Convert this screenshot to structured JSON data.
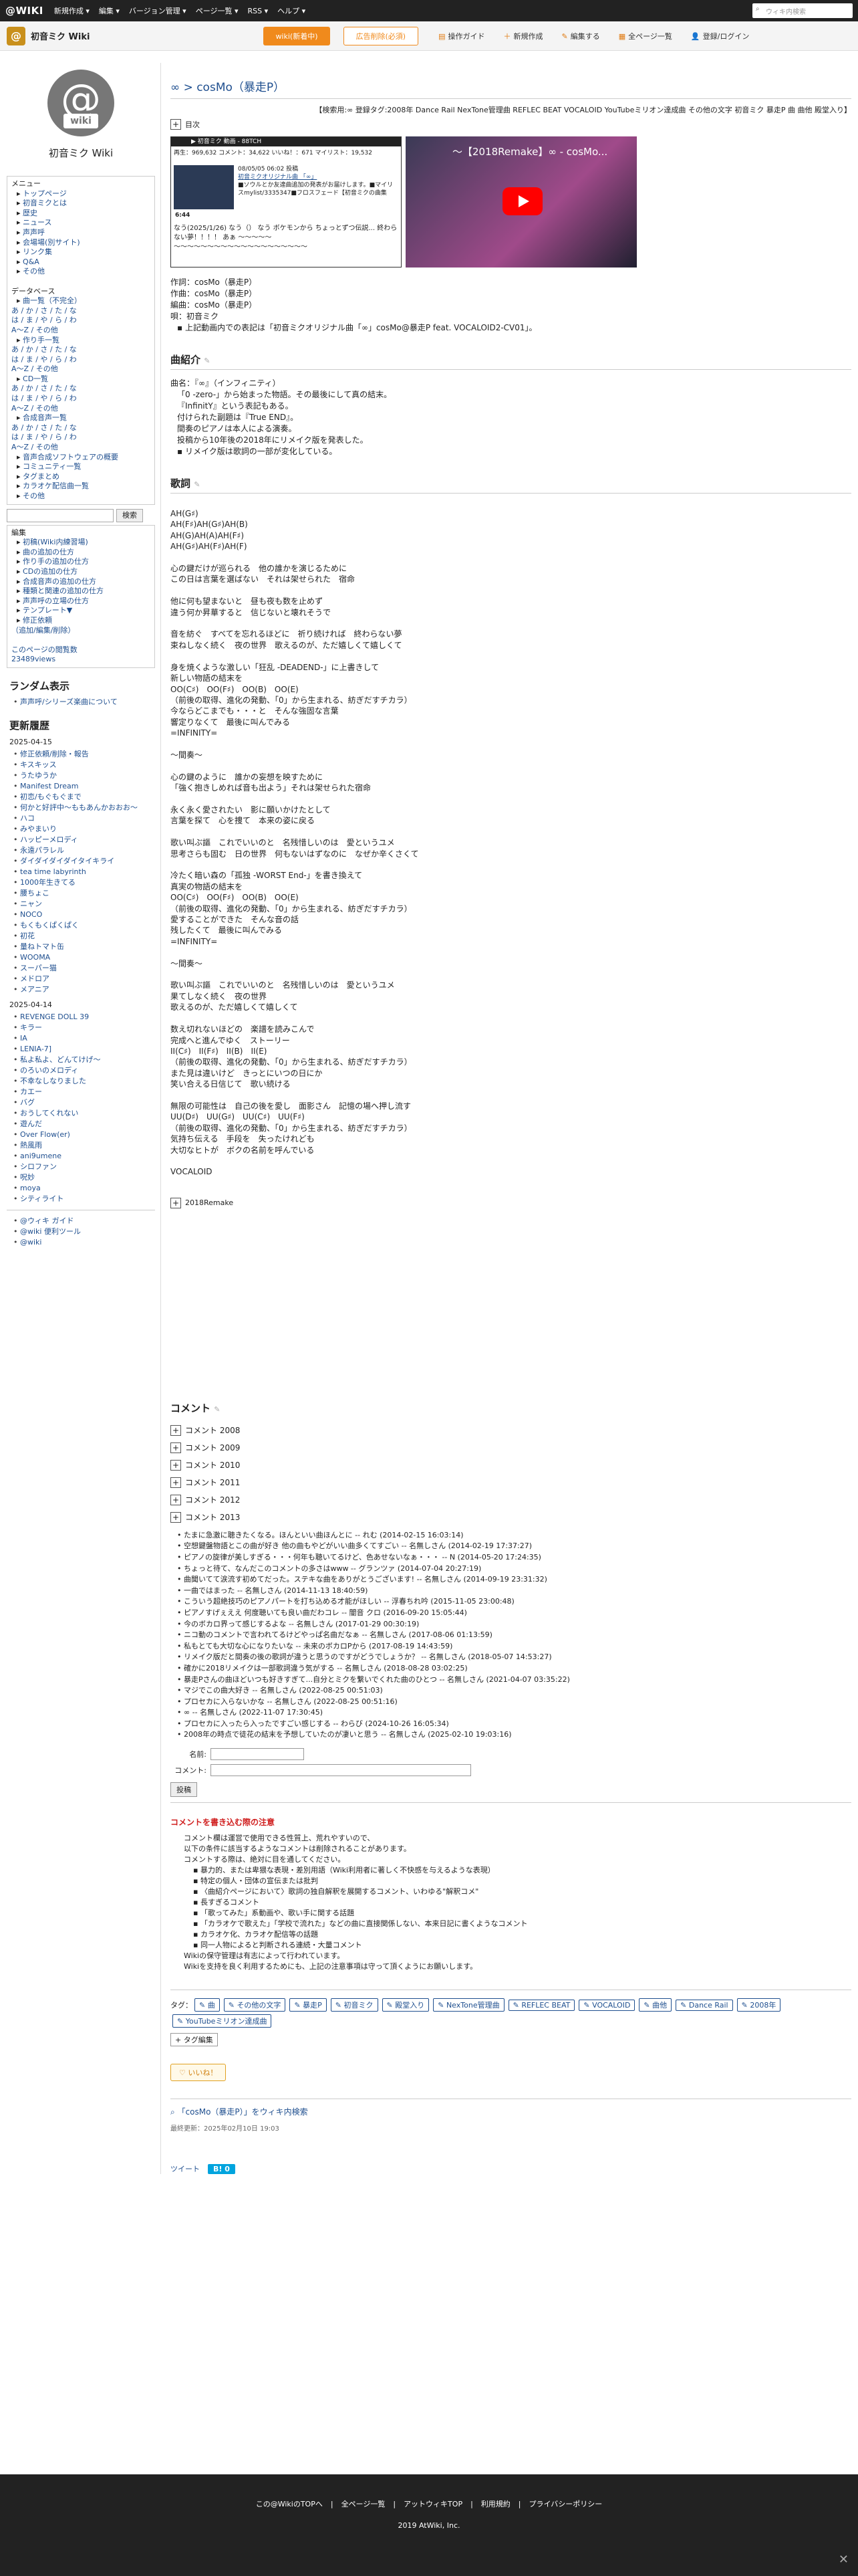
{
  "topbar": {
    "logo": "@WIKI",
    "menus": [
      "新規作成 ▾",
      "編集 ▾",
      "バージョン管理 ▾",
      "ページ一覧 ▾",
      "RSS ▾",
      "ヘルプ ▾"
    ],
    "search_placeholder": "ウィキ内検索"
  },
  "subbar": {
    "site_title": "初音ミク Wiki",
    "wiki_button": "wiki(新着中)",
    "ad_button": "広告削除(必須)",
    "tools": [
      "操作ガイド",
      "新規作成",
      "編集する",
      "全ページ一覧",
      "登録/ログイン"
    ]
  },
  "sidebar": {
    "sitename": "初音ミク Wiki",
    "menu": [
      {
        "text": "メニュー",
        "cls": "head"
      },
      {
        "text": "トップページ",
        "cls": "sub"
      },
      {
        "text": "初音ミクとは",
        "cls": "sub"
      },
      {
        "text": "歴史",
        "cls": "sub"
      },
      {
        "text": "ニュース",
        "cls": "sub"
      },
      {
        "text": "声声呼",
        "cls": "sub"
      },
      {
        "text": "会場場(別サイト)",
        "cls": "sub"
      },
      {
        "text": "リンク集",
        "cls": "sub"
      },
      {
        "text": "Q&A",
        "cls": "sub"
      },
      {
        "text": "その他",
        "cls": "sub"
      },
      {
        "text": "",
        "cls": ""
      },
      {
        "text": "データベース",
        "cls": "head"
      },
      {
        "text": "曲一覧（不完全）",
        "cls": "sub"
      },
      {
        "text": "あ / か / さ / た / な",
        "cls": ""
      },
      {
        "text": "は / ま / や / ら / わ",
        "cls": ""
      },
      {
        "text": "A〜Z / その他",
        "cls": ""
      },
      {
        "text": "作り手一覧",
        "cls": "sub"
      },
      {
        "text": "あ / か / さ / た / な",
        "cls": ""
      },
      {
        "text": "は / ま / や / ら / わ",
        "cls": ""
      },
      {
        "text": "A〜Z / その他",
        "cls": ""
      },
      {
        "text": "CD一覧",
        "cls": "sub"
      },
      {
        "text": "あ / か / さ / た / な",
        "cls": ""
      },
      {
        "text": "は / ま / や / ら / わ",
        "cls": ""
      },
      {
        "text": "A〜Z / その他",
        "cls": ""
      },
      {
        "text": "合成音声一覧",
        "cls": "sub"
      },
      {
        "text": "あ / か / さ / た / な",
        "cls": ""
      },
      {
        "text": "は / ま / や / ら / わ",
        "cls": ""
      },
      {
        "text": "A〜Z / その他",
        "cls": ""
      },
      {
        "text": "音声合成ソフトウェアの概要",
        "cls": "sub"
      },
      {
        "text": "コミュニティ一覧",
        "cls": "sub"
      },
      {
        "text": "タグまとめ",
        "cls": "sub"
      },
      {
        "text": "カラオケ配信曲一覧",
        "cls": "sub"
      },
      {
        "text": "その他",
        "cls": "sub"
      }
    ],
    "search_button": "検索",
    "edit_menu": [
      {
        "text": "編集",
        "cls": "head"
      },
      {
        "text": "初稿(Wiki内練習場)",
        "cls": "sub"
      },
      {
        "text": "曲の追加の仕方",
        "cls": "sub"
      },
      {
        "text": "作り手の追加の仕方",
        "cls": "sub"
      },
      {
        "text": "CDの追加の仕方",
        "cls": "sub"
      },
      {
        "text": "合成音声の追加の仕方",
        "cls": "sub"
      },
      {
        "text": "種類と関連の追加の仕方",
        "cls": "sub"
      },
      {
        "text": "声声呼の立場の仕方",
        "cls": "sub"
      },
      {
        "text": "テンプレート▼",
        "cls": "sub"
      },
      {
        "text": "修正依頼",
        "cls": "sub"
      },
      {
        "text": "（追加/編集/削除）",
        "cls": ""
      },
      {
        "text": "",
        "cls": ""
      },
      {
        "text": "このページの閲覧数",
        "cls": ""
      },
      {
        "text": "23489views",
        "cls": ""
      }
    ],
    "random_title": "ランダム表示",
    "random_item": "声声呼/シリーズ楽曲について",
    "recent_title": "更新履歴",
    "date1": "2025-04-15",
    "recent1": [
      "修正依頼/削除・報告",
      "キスキッス",
      "うたゆうか",
      "Manifest Dream",
      "初恋/もぐもぐまで",
      "何かと好評中〜ももあんかおおお〜",
      "ハコ",
      "みやまいり",
      "ハッピーメロディ",
      "永遠パラレル",
      "ダイダイダイダイタイキライ",
      "tea time labyrinth",
      "1000年生きてる",
      "腰ちょこ",
      "ニャン",
      "NOCO",
      "もくもくぱくぱく",
      "初花",
      "量ねトマト缶",
      "WOOMA",
      "スーパー猫",
      "メドロア",
      "メアニア"
    ],
    "date2": "2025-04-14",
    "recent2": [
      "REVENGE DOLL 39",
      "キラー",
      "IA",
      "LENIA-7]",
      "私よ私よ、どんてけげ〜",
      "のろいのメロディ",
      "不幸なしなりました",
      "カエー",
      "バグ",
      "おうしてくれない",
      "遊んだ",
      "Over Flow(er)",
      "熱風雨",
      "ani9umene",
      "シロファン",
      "呪妙",
      "moya",
      "シティライト"
    ],
    "footer_links": [
      "@ウィキ ガイド",
      "@wiki 便利ツール",
      "@wiki"
    ]
  },
  "main": {
    "page_title": "∞ > cosMo（暴走P）",
    "tagsline": "【検索用:∞ 登録タグ:2008年 Dance Rail NexTone管理曲 REFLEC BEAT VOCALOID YouTubeミリオン達成曲 その他の文字 初音ミク 暴走P 曲 曲他 殿堂入り】",
    "toc": "目次",
    "video1": {
      "header": "▶ 初音ミク 動画 - 88TCH",
      "stats": "再生：969,632 コメント：34,622 いいね！：671 マイリスト：19,532",
      "date": "08/05/05 06:02 投稿",
      "title": "初音ミクオリジナル曲 「∞」",
      "sub": "■ソウルとか友達曲追加の発表がお届けします。■マイリスmylist/3335347■フロスフェード【初音ミクの曲集",
      "duration": "6:44",
      "desc": "なう(2025/1/26) なう（） なう ボケモンから ちょっとずつ伝説... 終わらない夢！！！！ あぁ 〜〜〜〜〜 〜〜〜〜〜〜〜〜〜〜〜〜〜〜〜〜〜〜〜〜"
    },
    "video2": {
      "title": "〜【2018Remake】∞ - cosMo..."
    },
    "credits": [
      "作詞：cosMo（暴走P）",
      "作曲：cosMo（暴走P）",
      "編曲：cosMo（暴走P）",
      "唄：初音ミク"
    ],
    "credit_note": "▪ 上記動画内での表記は「初音ミクオリジナル曲「∞」cosMo@暴走P feat. VOCALOID2-CV01」。",
    "intro_title": "曲紹介",
    "intro_lines": [
      "曲名：『∞』（インフィニティ）",
      "「0 -zero-」から始まった物語。その最後にして真の結末。",
      "『InfinitY』という表記もある。",
      "付けられた副題は『True END』。",
      "間奏のピアノは本人による演奏。",
      "投稿から10年後の2018年にリメイク版を発表した。",
      "  ▪ リメイク版は歌詞の一部が変化している。"
    ],
    "lyrics_title": "歌詞",
    "lyrics": "AH(G♯)\nAH(F♯)AH(G♯)AH(B)\nAH(G)AH(A)AH(F♯)\nAH(G♯)AH(F♯)AH(F)\n\n心の鍵だけが巡られる　他の誰かを演じるために\nこの日は言葉を選ばない　それは架せられた　宿命\n\n他に何も望まないと　昼も夜も数を止めず\n違う何か昇華すると　信じないと壊れそうで\n\n音を紡ぐ　すべてを忘れるほどに　祈り続ければ　終わらない夢\n束ねしなく続く　夜の世界　歌えるのが、ただ嬉しくて嬉しくて\n\n身を焼くような激しい「狂乱 -DEADEND-」に上書きして\n新しい物語の結末を\nOO(C♯)　OO(F♯)　OO(B)　OO(E)\n（前後の取得、進化の発動、「0」から生まれる、紡ぎだすチカラ）\n今ならどこまでも・・・と　そんな強固な言葉\n響定りなくて　最後に叫んでみる\n=INFINITY=\n\n〜間奏〜\n\n心の鍵のように　誰かの妄想を映すために\n「強く抱きしめれば音も出よう」それは架せられた宿命\n\n永く永く愛されたい　影に願いかけたとして\n言葉を探て　心を捜て　本来の姿に戻る\n\n歌い叫ぶ謳　これでいいのと　名残惜しいのは　愛というユメ\n思考さらも固む　日の世界　何もないはずなのに　なぜか辛くさくて\n\n冷たく暗い森の「孤独 -WORST End-」を書き換えて\n真実の物語の結末を\nOO(C♯)　OO(F♯)　OO(B)　OO(E)\n（前後の取得、進化の発動、「0」から生まれる、紡ぎだすチカラ）\n愛することができた　そんな音の話\n残したくて　最後に叫んでみる\n=INFINITY=\n\n〜間奏〜\n\n歌い叫ぶ謳　これでいいのと　名残惜しいのは　愛というユメ\n果てしなく続く　夜の世界\n歌えるのが、ただ嬉しくて嬉しくて\n\n数え切れないほどの　楽譜を読みこんで\n完成へと進んでゆく　ストーリー\nII(C♯)　II(F♯)　II(B)　II(E)\n（前後の取得、進化の発動、「0」から生まれる、紡ぎだすチカラ）\nまた見は違いけど　きっとにいつの日にか\n笑い合える日信じて　歌い続ける\n\n無限の可能性は　自己の後を愛し　面影さん　記憶の場へ押し流す\nUU(D♯)　UU(G♯)　UU(C♯)　UU(F♯)\n（前後の取得、進化の発動、「0」から生まれる、紡ぎだすチカラ）\n気持ち伝える　手段を　失ったけれども\n大切なヒトが　ボクの名前を呼んでいる\n\nVOCALOID",
    "remake_toggle": "2018Remake",
    "comments_title": "コメント",
    "comment_years": [
      "コメント 2008",
      "コメント 2009",
      "コメント 2010",
      "コメント 2011",
      "コメント 2012",
      "コメント 2013"
    ],
    "comments": [
      "たまに急激に聴きたくなる。ほんといい曲ほんとに -- れむ (2014-02-15 16:03:14)",
      "空想鍵盤物語とこの曲が好き 他の曲もやどがいい曲多くてすごい -- 名無しさん (2014-02-19 17:37:27)",
      "ピアノの旋律が美しすぎる・・・何年も聴いてるけど、色あせないなぁ・・・ -- N (2014-05-20 17:24:35)",
      "ちょっと待て、なんだこのコメントの多さはwww -- グランツァ (2014-07-04 20:27:19)",
      "曲聞いてて涙流す初めてだった。ステキな曲をありがとうございます! -- 名無しさん (2014-09-19 23:31:32)",
      "一曲ではまった -- 名無しさん (2014-11-13 18:40:59)",
      "こういう超絶技巧のピアノパートを打ち込める才能がほしい -- 浮春ちれ吟 (2015-11-05 23:00:48)",
      "ピアノすげぇええ 何度聴いても良い曲だわコレ -- 闇音 クロ (2016-09-20 15:05:44)",
      "今のボカロ界って感じするよな -- 名無しさん (2017-01-29 00:30:19)",
      "ニコ動のコメントで言われてるけどやっぱ名曲だなぁ -- 名無しさん (2017-08-06 01:13:59)",
      "私もとても大切な心になりたいな -- 未来のボカロPから (2017-08-19 14:43:59)",
      "リメイク版だと間奏の後の歌詞が違うと思うのですがどうでしょうか？ -- 名無しさん (2018-05-07 14:53:27)",
      "確かに2018リメイクは一部歌詞違う気がする -- 名無しさん (2018-08-28 03:02:25)",
      "暴走Pさんの曲ほどいつも好きすぎて...自分とミクを繋いでくれた曲のひとつ -- 名無しさん (2021-04-07 03:35:22)",
      "マジでこの曲大好き -- 名無しさん (2022-08-25 00:51:03)",
      "プロセカに入らないかな -- 名無しさん (2022-08-25 00:51:16)",
      "∞ -- 名無しさん (2022-11-07 17:30:45)",
      "プロセカに入ったら入ったですごい感じする -- わらび (2024-10-26 16:05:34)",
      "2008年の時点で徒花の結末を予想していたのが凄いと思う -- 名無しさん (2025-02-10 19:03:16)"
    ],
    "form_name_label": "名前:",
    "form_comment_label": "コメント:",
    "submit_label": "投稿",
    "notice_title": "コメントを書き込む際の注意",
    "notice_lines": [
      {
        "t": "コメント欄は運営で使用できる性質上、荒れやすいので、",
        "li": false
      },
      {
        "t": "以下の条件に該当するようなコメントは削除されることがあります。",
        "li": false
      },
      {
        "t": "コメントする際は、絶対に目を通してください。",
        "li": false
      },
      {
        "t": "▪ 暴力的、または卑猥な表現・差別用語（Wiki利用者に著しく不快感を与えるような表現）",
        "li": true
      },
      {
        "t": "▪ 特定の個人・団体の宣伝または批判",
        "li": true
      },
      {
        "t": "▪ 〈曲紹介ページにおいて〉歌詞の独自解釈を展開するコメント、いわゆる\"解釈コメ\"",
        "li": true
      },
      {
        "t": "▪ 長すぎるコメント",
        "li": true
      },
      {
        "t": "▪ 「歌ってみた」系動画や、歌い手に関する話題",
        "li": true
      },
      {
        "t": "▪ 「カラオケで歌えた」「学校で流れた」などの曲に直接関係しない、本来日記に書くようなコメント",
        "li": true
      },
      {
        "t": "▪ カラオケ化、カラオケ配信等の話題",
        "li": true
      },
      {
        "t": "▪ 同一人物によると判断される連続・大量コメント",
        "li": true
      },
      {
        "t": "Wikiの保守管理は有志によって行われています。",
        "li": false
      },
      {
        "t": "Wikiを支持を良く利用するためにも、上記の注意事項は守って頂くようにお願いします。",
        "li": false
      }
    ],
    "tags_label": "タグ：",
    "tags": [
      "曲",
      "その他の文字",
      "暴走P",
      "初音ミク",
      "殿堂入り",
      "NexTone管理曲",
      "REFLEC BEAT",
      "VOCALOID",
      "曲他",
      "Dance Rail",
      "2008年",
      "YouTubeミリオン達成曲"
    ],
    "tag_edit": "タグ編集",
    "iine": "♡ いいね！",
    "search_link": "「cosMo（暴走P）」をウィキ内検索",
    "updated": "最終更新：2025年02月10日 19:03",
    "tweet": "ツイート",
    "hatena": "B! 0"
  },
  "footer": {
    "links": [
      "この@WikiのTOPへ",
      "全ページ一覧",
      "アットウィキTOP",
      "利用規約",
      "プライバシーポリシー"
    ],
    "copy": "2019 AtWiki, Inc."
  }
}
